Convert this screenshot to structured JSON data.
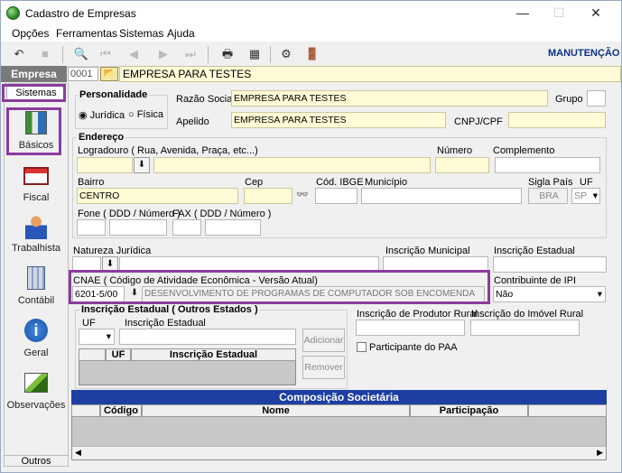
{
  "window": {
    "title": "Cadastro de Empresas",
    "minimize": "—",
    "maximize": "☐",
    "close": "✕"
  },
  "menu": [
    "Opções",
    "Ferramentas",
    "Sistemas",
    "Ajuda"
  ],
  "toolbar": {
    "mode": "MANUTENÇÃO"
  },
  "empresa": {
    "label": "Empresa",
    "code": "0001",
    "name": "EMPRESA PARA TESTES"
  },
  "sidebar": {
    "header": "Sistemas",
    "items": [
      {
        "label": "Básicos",
        "icon": "books-icon"
      },
      {
        "label": "Fiscal",
        "icon": "fiscal-icon"
      },
      {
        "label": "Trabalhista",
        "icon": "worker-icon"
      },
      {
        "label": "Contábil",
        "icon": "calculator-icon"
      },
      {
        "label": "Geral",
        "icon": "info-icon"
      },
      {
        "label": "Observações",
        "icon": "notes-icon"
      }
    ],
    "footer": "Outros"
  },
  "personalidade": {
    "title": "Personalidade",
    "options": [
      "Jurídica",
      "Física"
    ],
    "selected": "Jurídica"
  },
  "razao_social": {
    "label": "Razão Social",
    "value": "EMPRESA PARA TESTES"
  },
  "grupo": {
    "label": "Grupo",
    "value": ""
  },
  "apelido": {
    "label": "Apelido",
    "value": "EMPRESA PARA TESTES"
  },
  "cnpj": {
    "label": "CNPJ/CPF",
    "value": ""
  },
  "endereco": {
    "title": "Endereço",
    "logradouro_label": "Logradouro ( Rua, Avenida, Praça, etc...)",
    "numero_label": "Número",
    "complemento_label": "Complemento",
    "bairro_label": "Bairro",
    "bairro_value": "CENTRO",
    "cep_label": "Cep",
    "ibge_label": "Cód. IBGE",
    "municipio_label": "Município",
    "sigla_label": "Sigla País",
    "sigla_value": "BRA",
    "uf_label": "UF",
    "uf_value": "SP",
    "fone_label": "Fone ( DDD / Número )",
    "fax_label": "FAX ( DDD / Número )"
  },
  "natureza": {
    "label": "Natureza Jurídica"
  },
  "insc_municipal": {
    "label": "Inscrição Municipal"
  },
  "insc_estadual": {
    "label": "Inscrição Estadual"
  },
  "cnae": {
    "label": "CNAE ( Código de Atividade Econômica - Versão Atual)",
    "code": "6201-5/00",
    "desc": "DESENVOLVIMENTO DE PROGRAMAS DE COMPUTADOR SOB ENCOMENDA"
  },
  "ipi": {
    "label": "Contribuinte de IPI",
    "value": "Não"
  },
  "outros_estados": {
    "title": "Inscrição Estadual ( Outros Estados )",
    "uf_label": "UF",
    "ie_label": "Inscrição Estadual",
    "add": "Adicionar",
    "remove": "Remover",
    "col_uf": "UF",
    "col_ie": "Inscrição Estadual"
  },
  "produtor": {
    "label": "Inscrição de Produtor Rural"
  },
  "imovel": {
    "label": "Inscrição do Imóvel Rural"
  },
  "paa": {
    "label": "Participante do PAA"
  },
  "composicao": {
    "title": "Composição Societária",
    "cols": [
      "Código",
      "Nome",
      "Participação"
    ]
  }
}
